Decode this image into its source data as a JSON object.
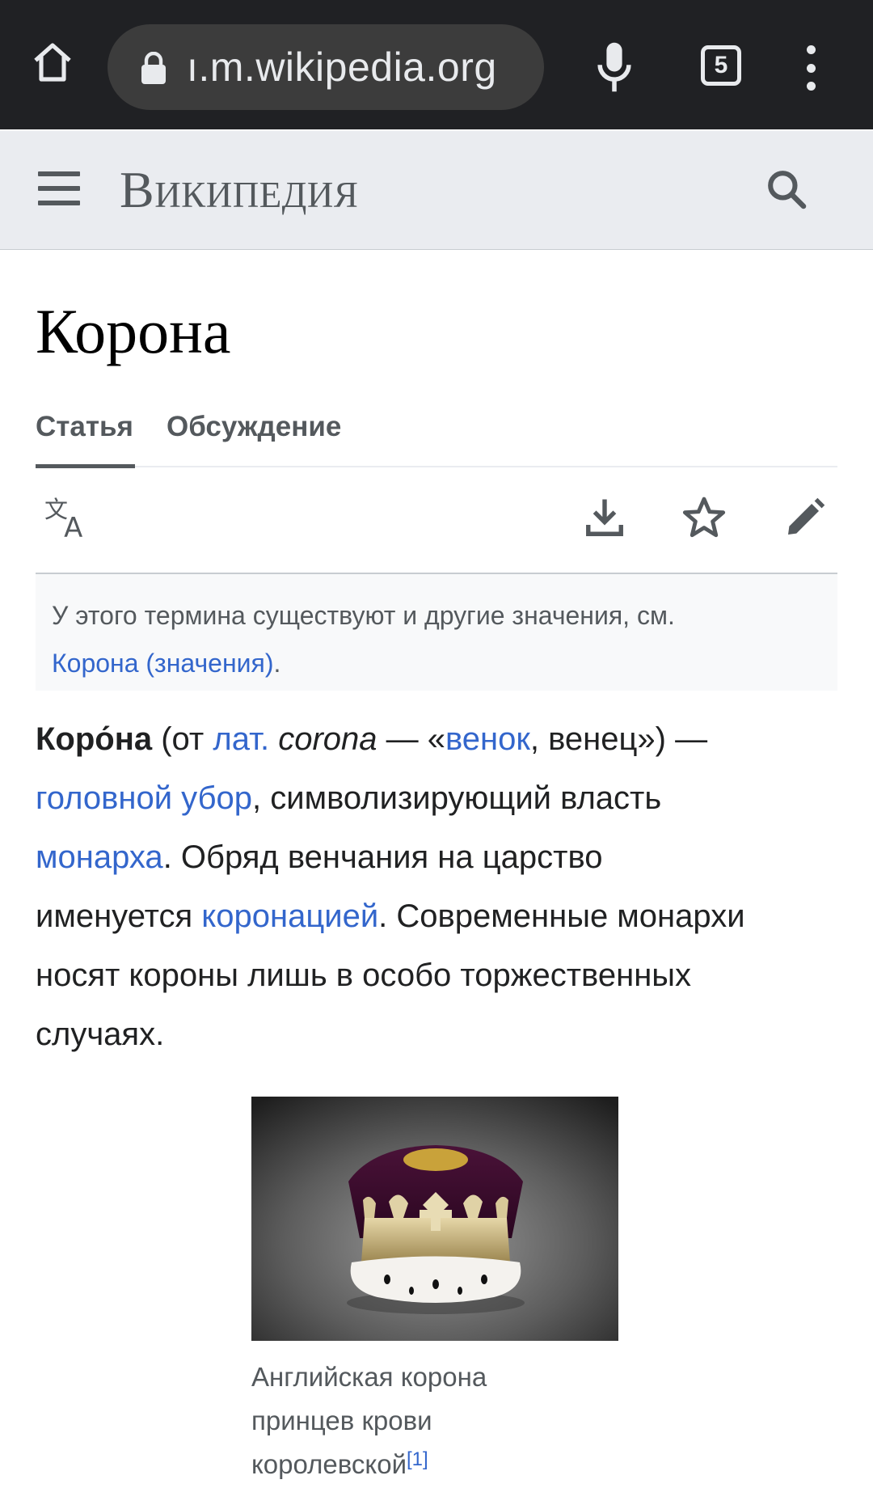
{
  "browser": {
    "url": "ı.m.wikipedia.org",
    "tab_count": "5",
    "bar_color": "#202124"
  },
  "header": {
    "wordmark": "Википедия"
  },
  "page": {
    "title": "Корона",
    "tabs": [
      {
        "label": "Статья",
        "selected": true
      },
      {
        "label": "Обсуждение",
        "selected": false
      }
    ]
  },
  "actions": {
    "items": [
      {
        "icon": "translate-icon",
        "name": "language"
      },
      {
        "icon": "download-icon",
        "name": "download"
      },
      {
        "icon": "star-icon",
        "name": "watch"
      },
      {
        "icon": "pencil-icon",
        "name": "edit"
      }
    ]
  },
  "hatnote": {
    "text": "У этого термина существуют и другие значения, см.",
    "link": "Корона (значения)",
    "end": "."
  },
  "lead": {
    "term": "Коро́на",
    "t1": " (от ",
    "link_lat": "лат.",
    "t2": " ",
    "latin": "corona",
    "t3": " — «",
    "link_venok": "венок",
    "t4": ", венец») —",
    "link_headwear": "головной убор",
    "t5": ", символизирующий власть",
    "link_monarch": "монарха",
    "t6": ". Обряд венчания на царство",
    "t7": "именуется ",
    "link_coronation": "коронацией",
    "t8": ". Современные монархи",
    "t9": "носят короны лишь в особо торжественных",
    "t10": "случаях."
  },
  "figure": {
    "caption_line1": "Английская корона",
    "caption_line2": "принцев крови",
    "caption_line3": "королевской",
    "footnote": "[1]"
  },
  "colors": {
    "link": "#3366cc",
    "text": "#202122",
    "muted": "#54595d",
    "header_bg": "#eaecf0"
  }
}
